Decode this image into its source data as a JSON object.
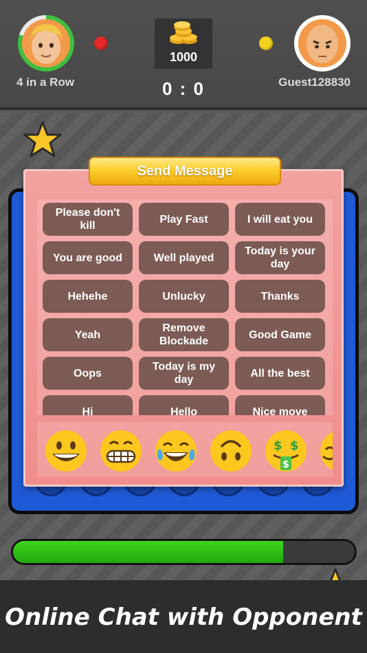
{
  "header": {
    "player_left": {
      "name": "4 in a Row",
      "avatar": "blond-boy-avatar",
      "timer_fraction": 0.8
    },
    "player_right": {
      "name": "Guest128830",
      "avatar": "bald-man-avatar"
    },
    "coins": "1000",
    "score": "0 : 0",
    "colors": {
      "left_piece": "#e52929",
      "right_piece": "#f4d21c"
    }
  },
  "dialog": {
    "title": "Send Message",
    "messages": [
      "Please don't kill",
      "Play Fast",
      "I will eat you",
      "You are good",
      "Well played",
      "Today is your day",
      "Hehehe",
      "Unlucky",
      "Thanks",
      "Yeah",
      "Remove Blockade",
      "Good Game",
      "Oops",
      "Today is my day",
      "All the best",
      "Hi",
      "Hello",
      "Nice move"
    ],
    "emojis": [
      "grinning-face-icon",
      "grimacing-face-icon",
      "tears-of-joy-icon",
      "upside-down-face-icon",
      "money-mouth-face-icon",
      "partial-emoji-icon"
    ]
  },
  "progress": 0.79,
  "footer": {
    "caption": "Online Chat with Opponent"
  }
}
